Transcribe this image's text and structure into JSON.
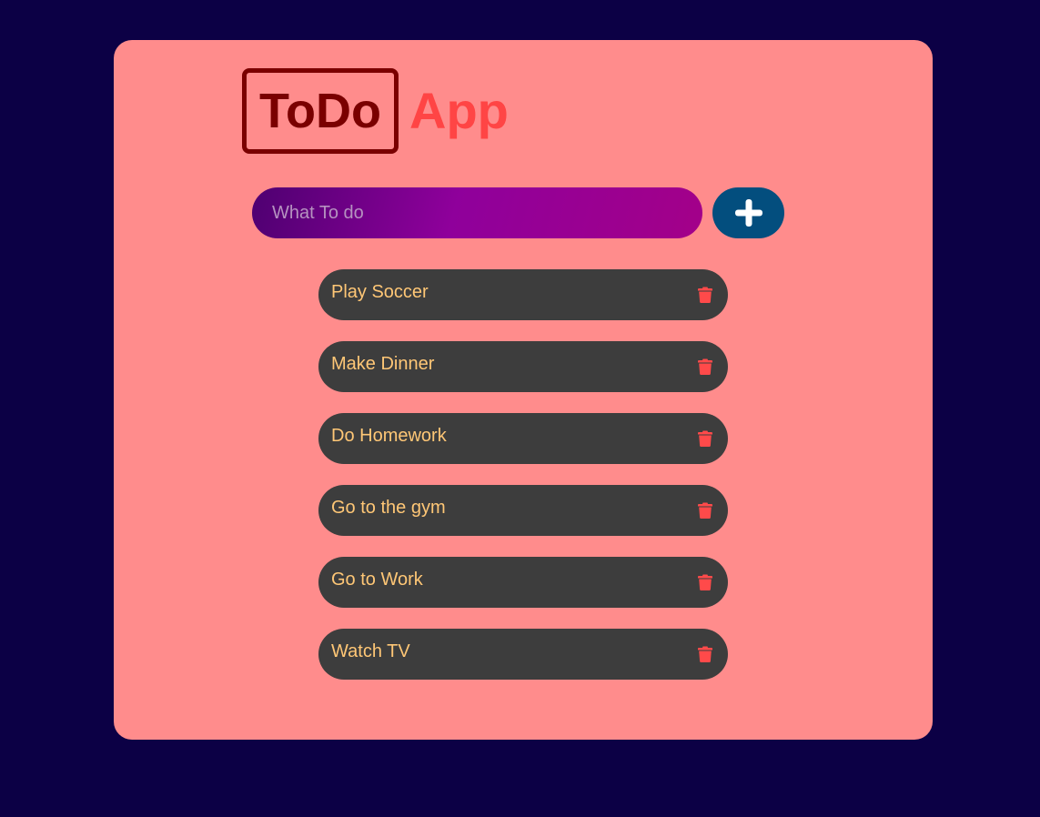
{
  "colors": {
    "page_background": "#0c0045",
    "card_background": "#ff8c8c",
    "logo_dark": "#7a0000",
    "logo_accent": "#ff4545",
    "input_gradient_start": "#4e0071",
    "input_gradient_end": "#a30089",
    "add_button": "#034e7e",
    "item_background": "#3d3d3d",
    "item_text": "#ffc776",
    "delete_icon": "#ff4a4a"
  },
  "header": {
    "logo_boxed": "ToDo",
    "logo_accent": "App"
  },
  "input": {
    "placeholder": "What To do",
    "value": ""
  },
  "add_button": {
    "icon": "plus-icon"
  },
  "todos": [
    {
      "label": "Play Soccer",
      "icon": "trash-icon"
    },
    {
      "label": "Make Dinner",
      "icon": "trash-icon"
    },
    {
      "label": "Do Homework",
      "icon": "trash-icon"
    },
    {
      "label": "Go to the gym",
      "icon": "trash-icon"
    },
    {
      "label": "Go to Work",
      "icon": "trash-icon"
    },
    {
      "label": "Watch TV",
      "icon": "trash-icon"
    }
  ]
}
